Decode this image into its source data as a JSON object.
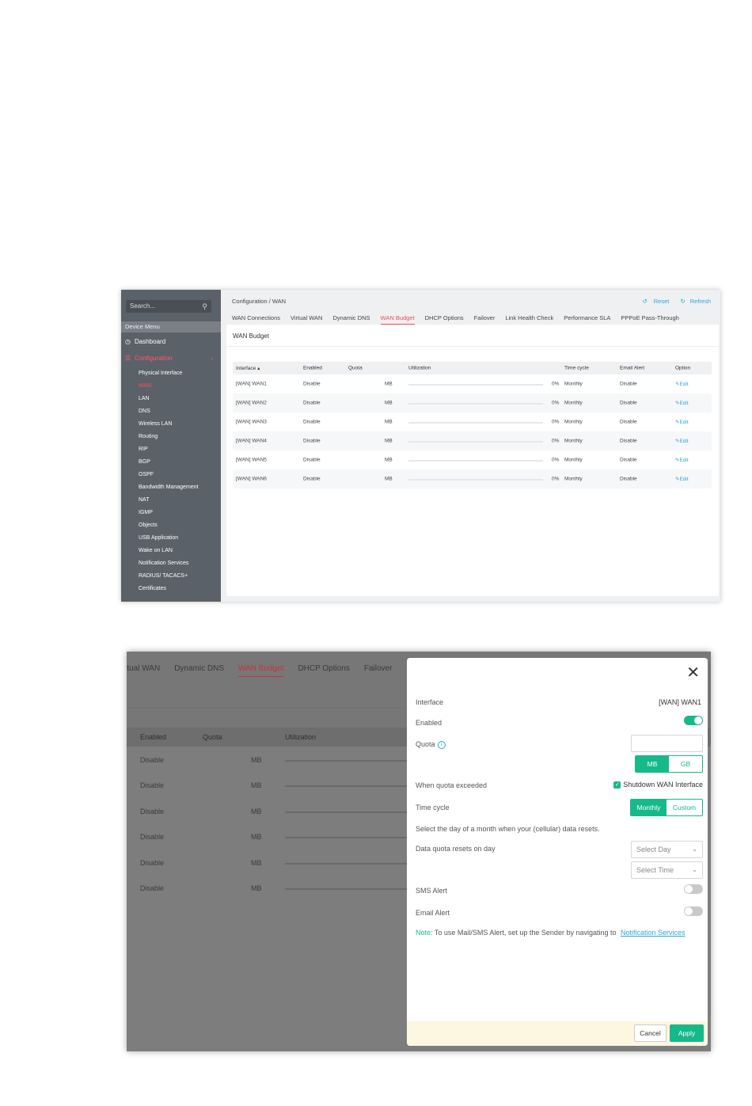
{
  "sidebar": {
    "search_placeholder": "Search...",
    "section_label": "Device Menu",
    "dashboard": "Dashboard",
    "configuration": "Configuration",
    "items": [
      "Physical Interface",
      "WAN",
      "LAN",
      "DNS",
      "Wireless LAN",
      "Routing",
      "RIP",
      "BGP",
      "OSPF",
      "Bandwidth Management",
      "NAT",
      "IGMP",
      "Objects",
      "USB Application",
      "Wake on LAN",
      "Notification Services",
      "RADIUS/ TACACS+",
      "Certificates"
    ],
    "active_item": "WAN"
  },
  "header": {
    "breadcrumb": "Configuration / WAN",
    "reset": "Reset",
    "refresh": "Refresh"
  },
  "tabs": [
    "WAN Connections",
    "Virtual WAN",
    "Dynamic DNS",
    "WAN Budget",
    "DHCP Options",
    "Failover",
    "Link Health Check",
    "Performance SLA",
    "PPPoE Pass-Through"
  ],
  "active_tab": "WAN Budget",
  "panel_title": "WAN Budget",
  "table": {
    "columns": {
      "interface": "Interface ▴",
      "enabled": "Enabled",
      "quota": "Quota",
      "utilization": "Utilization",
      "time_cycle": "Time cycle",
      "email_alert": "Email Alert",
      "option": "Option"
    },
    "rows": [
      {
        "interface": "[WAN] WAN1",
        "enabled": "Disable",
        "unit": "MB",
        "utilization": "0%",
        "utilization_fraction": 0,
        "time_cycle": "Monthly",
        "email_alert": "Disable",
        "option": "Edit"
      },
      {
        "interface": "[WAN] WAN2",
        "enabled": "Disable",
        "unit": "MB",
        "utilization": "0%",
        "utilization_fraction": 0,
        "time_cycle": "Monthly",
        "email_alert": "Disable",
        "option": "Edit"
      },
      {
        "interface": "[WAN] WAN3",
        "enabled": "Disable",
        "unit": "MB",
        "utilization": "0%",
        "utilization_fraction": 0,
        "time_cycle": "Monthly",
        "email_alert": "Disable",
        "option": "Edit"
      },
      {
        "interface": "[WAN] WAN4",
        "enabled": "Disable",
        "unit": "MB",
        "utilization": "0%",
        "utilization_fraction": 0,
        "time_cycle": "Monthly",
        "email_alert": "Disable",
        "option": "Edit"
      },
      {
        "interface": "[WAN] WAN5",
        "enabled": "Disable",
        "unit": "MB",
        "utilization": "0%",
        "utilization_fraction": 0,
        "time_cycle": "Monthly",
        "email_alert": "Disable",
        "option": "Edit"
      },
      {
        "interface": "[WAN] WAN6",
        "enabled": "Disable",
        "unit": "MB",
        "utilization": "0%",
        "utilization_fraction": 0,
        "time_cycle": "Monthly",
        "email_alert": "Disable",
        "option": "Edit"
      }
    ]
  },
  "second_view": {
    "tabs": [
      "rtual WAN",
      "Dynamic DNS",
      "WAN Budget",
      "DHCP Options",
      "Failover"
    ],
    "active_tab": "WAN Budget",
    "columns": {
      "enabled": "Enabled",
      "quota": "Quota",
      "utilization": "Utilization"
    },
    "rows": [
      {
        "enabled": "Disable",
        "unit": "MB"
      },
      {
        "enabled": "Disable",
        "unit": "MB"
      },
      {
        "enabled": "Disable",
        "unit": "MB"
      },
      {
        "enabled": "Disable",
        "unit": "MB"
      },
      {
        "enabled": "Disable",
        "unit": "MB"
      },
      {
        "enabled": "Disable",
        "unit": "MB"
      }
    ]
  },
  "dialog": {
    "close_icon": "close-icon",
    "interface_label": "Interface",
    "interface_value": "[WAN] WAN1",
    "enabled_label": "Enabled",
    "enabled_on": true,
    "quota_label": "Quota",
    "quota_value": "",
    "unit_mb": "MB",
    "unit_gb": "GB",
    "selected_unit": "MB",
    "exceeded_label": "When quota exceeded",
    "shutdown_label": "Shutdown WAN Interface",
    "shutdown_checked": true,
    "time_cycle_label": "Time cycle",
    "monthly": "Monthly",
    "custom": "Custom",
    "selected_cycle": "Monthly",
    "reset_hint": "Select the day of a month when your (cellular) data resets.",
    "reset_label": "Data quota resets on day",
    "select_day": "Select Day",
    "select_time": "Select Time",
    "sms_label": "SMS Alert",
    "sms_on": false,
    "email_label": "Email Alert",
    "email_on": false,
    "note_label": "Note:",
    "note_text": "To use Mail/SMS Alert, set up the Sender by navigating to",
    "note_link": "Notification Services",
    "cancel": "Cancel",
    "apply": "Apply"
  },
  "colors": {
    "accent_green": "#16b98a",
    "accent_red": "#e8505b",
    "link_blue": "#2aa7d6",
    "sidebar_bg": "#5b6168"
  }
}
